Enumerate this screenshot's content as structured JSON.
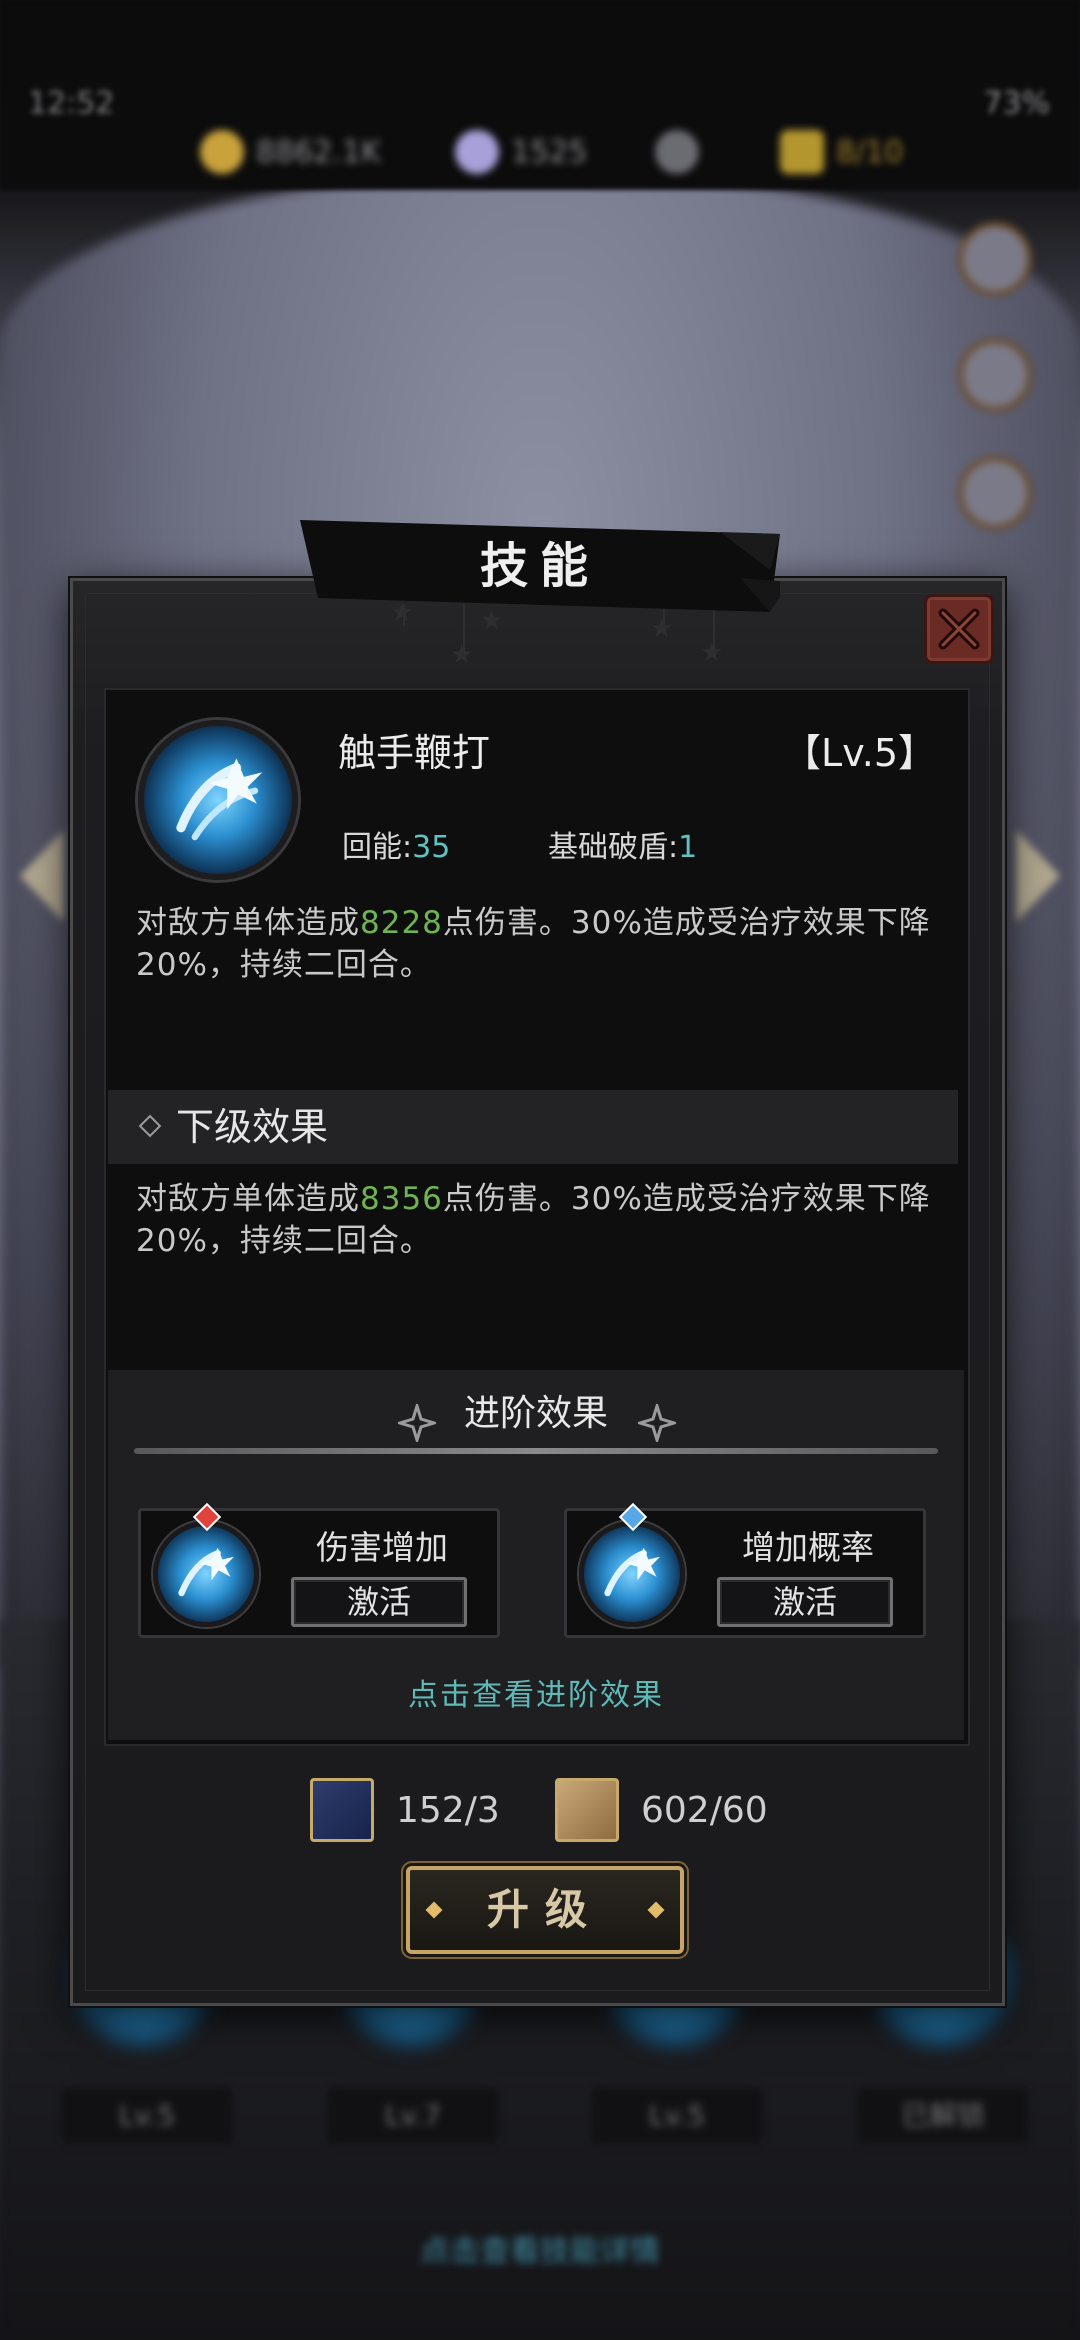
{
  "background": {
    "status_time": "12:52",
    "battery": "73%",
    "resources": [
      {
        "icon": "gold-coin-icon",
        "value": "8862.1K"
      },
      {
        "icon": "gem-icon",
        "value": "1525"
      },
      {
        "icon": "energy-icon",
        "value": ""
      },
      {
        "icon": "ticket-icon",
        "value": "8/10"
      }
    ],
    "skill_levels": [
      "Lv.5",
      "Lv.7",
      "Lv.5",
      "已解锁"
    ],
    "hint": "点击查看技能详情"
  },
  "dialog": {
    "title": "技能",
    "skill": {
      "name": "触手鞭打",
      "level": "【Lv.5】",
      "energy_label": "回能:",
      "energy_value": "35",
      "break_label": "基础破盾:",
      "break_value": "1"
    },
    "current_effect": {
      "pre": "对敌方单体造成",
      "damage": "8228",
      "post": "点伤害。30%造成受治疗效果下降20%，持续二回合。"
    },
    "next_level": {
      "title": "下级效果",
      "pre": "对敌方单体造成",
      "damage": "8356",
      "post": "点伤害。30%造成受治疗效果下降20%，持续二回合。"
    },
    "advanced": {
      "title": "进阶效果",
      "cards": [
        {
          "name": "伤害增加",
          "button": "激活",
          "gem": "red"
        },
        {
          "name": "增加概率",
          "button": "激活",
          "gem": "blue"
        }
      ],
      "hint": "点击查看进阶效果"
    },
    "costs": [
      {
        "icon": "skill-book-icon",
        "value": "152/3"
      },
      {
        "icon": "scroll-icon",
        "value": "602/60"
      }
    ],
    "upgrade_label": "升级"
  },
  "colors": {
    "accent_teal": "#5fc3c1",
    "damage_green": "#6fb352",
    "gold_border": "#c7a467"
  }
}
